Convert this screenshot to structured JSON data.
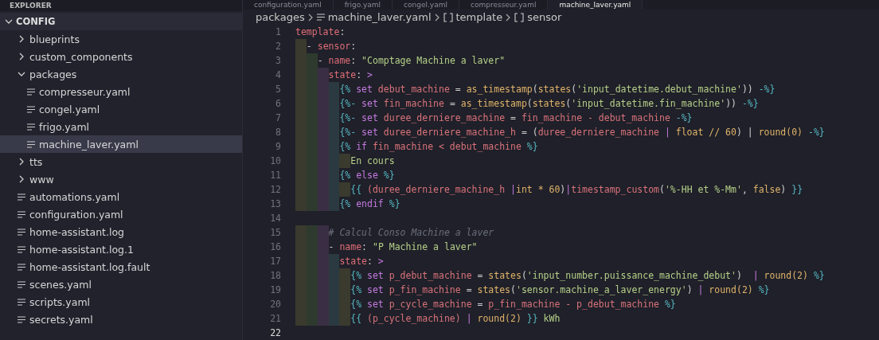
{
  "tabs": [
    {
      "label": "configuration.yaml",
      "selected": false
    },
    {
      "label": "frigo.yaml",
      "selected": false
    },
    {
      "label": "congel.yaml",
      "selected": false
    },
    {
      "label": "compresseur.yaml",
      "selected": false
    },
    {
      "label": "machine_laver.yaml",
      "selected": true
    }
  ],
  "sidebar": {
    "title": "EXPLORER",
    "section": "CONFIG",
    "section_expanded": true,
    "items": [
      {
        "label": "blueprints",
        "kind": "folder",
        "expanded": false,
        "selected": false
      },
      {
        "label": "custom_components",
        "kind": "folder",
        "expanded": false,
        "selected": false
      },
      {
        "label": "packages",
        "kind": "folder",
        "expanded": true,
        "selected": false,
        "children": [
          {
            "label": "compresseur.yaml",
            "kind": "file",
            "selected": false
          },
          {
            "label": "congel.yaml",
            "kind": "file",
            "selected": false
          },
          {
            "label": "frigo.yaml",
            "kind": "file",
            "selected": false
          },
          {
            "label": "machine_laver.yaml",
            "kind": "file",
            "selected": true
          }
        ]
      },
      {
        "label": "tts",
        "kind": "folder",
        "expanded": false,
        "selected": false
      },
      {
        "label": "www",
        "kind": "folder",
        "expanded": false,
        "selected": false
      },
      {
        "label": "automations.yaml",
        "kind": "file",
        "selected": false
      },
      {
        "label": "configuration.yaml",
        "kind": "file",
        "selected": false
      },
      {
        "label": "home-assistant.log",
        "kind": "file",
        "selected": false
      },
      {
        "label": "home-assistant.log.1",
        "kind": "file",
        "selected": false
      },
      {
        "label": "home-assistant.log.fault",
        "kind": "file",
        "selected": false
      },
      {
        "label": "scenes.yaml",
        "kind": "file",
        "selected": false
      },
      {
        "label": "scripts.yaml",
        "kind": "file",
        "selected": false
      },
      {
        "label": "secrets.yaml",
        "kind": "file",
        "selected": false
      }
    ]
  },
  "breadcrumb": [
    {
      "label": "packages",
      "kind": "folder"
    },
    {
      "label": "machine_laver.yaml",
      "kind": "file"
    },
    {
      "label": "template",
      "kind": "symbol"
    },
    {
      "label": "sensor",
      "kind": "symbol"
    }
  ],
  "editor": {
    "lines": [
      {
        "number": "1",
        "tokens": [
          {
            "text": "template",
            "kind": "key"
          },
          {
            "text": ":",
            "kind": "punct"
          }
        ]
      },
      {
        "number": "2",
        "tokens": [
          {
            "text": "  - ",
            "kind": "punct"
          },
          {
            "text": "sensor",
            "kind": "key"
          },
          {
            "text": ":",
            "kind": "punct"
          }
        ]
      },
      {
        "number": "3",
        "tokens": [
          {
            "text": "    - ",
            "kind": "punct"
          },
          {
            "text": "name",
            "kind": "key"
          },
          {
            "text": ": ",
            "kind": "punct"
          },
          {
            "text": "\"Comptage Machine a laver\"",
            "kind": "str"
          }
        ]
      },
      {
        "number": "4",
        "tokens": [
          {
            "text": "      state",
            "kind": "key"
          },
          {
            "text": ": ",
            "kind": "punct"
          },
          {
            "text": ">",
            "kind": "kw"
          }
        ]
      },
      {
        "number": "5",
        "tokens": [
          {
            "text": "        {%",
            "kind": "brace"
          },
          {
            "text": " set ",
            "kind": "kw"
          },
          {
            "text": "debut_machine",
            "kind": "var"
          },
          {
            "text": " = ",
            "kind": "punct"
          },
          {
            "text": "as_timestamp",
            "kind": "fn"
          },
          {
            "text": "(",
            "kind": "punct"
          },
          {
            "text": "states",
            "kind": "fn"
          },
          {
            "text": "(",
            "kind": "punct"
          },
          {
            "text": "'input_datetime.debut_machine'",
            "kind": "str"
          },
          {
            "text": ")) ",
            "kind": "punct"
          },
          {
            "text": "-%}",
            "kind": "brace"
          }
        ]
      },
      {
        "number": "6",
        "tokens": [
          {
            "text": "        {%-",
            "kind": "brace"
          },
          {
            "text": " set ",
            "kind": "kw"
          },
          {
            "text": "fin_machine",
            "kind": "var"
          },
          {
            "text": " = ",
            "kind": "punct"
          },
          {
            "text": "as_timestamp",
            "kind": "fn"
          },
          {
            "text": "(",
            "kind": "punct"
          },
          {
            "text": "states",
            "kind": "fn"
          },
          {
            "text": "(",
            "kind": "punct"
          },
          {
            "text": "'input_datetime.fin_machine'",
            "kind": "str"
          },
          {
            "text": ")) ",
            "kind": "punct"
          },
          {
            "text": "-%}",
            "kind": "brace"
          }
        ]
      },
      {
        "number": "7",
        "tokens": [
          {
            "text": "        {%-",
            "kind": "brace"
          },
          {
            "text": " set ",
            "kind": "kw"
          },
          {
            "text": "duree_derniere_machine",
            "kind": "var"
          },
          {
            "text": " = ",
            "kind": "punct"
          },
          {
            "text": "fin_machine - debut_machine",
            "kind": "var"
          },
          {
            "text": " -%}",
            "kind": "brace"
          }
        ]
      },
      {
        "number": "8",
        "tokens": [
          {
            "text": "        {%-",
            "kind": "brace"
          },
          {
            "text": " set ",
            "kind": "kw"
          },
          {
            "text": "duree_derniere_machine_h",
            "kind": "var"
          },
          {
            "text": " = (",
            "kind": "punct"
          },
          {
            "text": "duree_derniere_machine",
            "kind": "var"
          },
          {
            "text": " | ",
            "kind": "kw"
          },
          {
            "text": "float // 60",
            "kind": "fn"
          },
          {
            "text": ") | ",
            "kind": "punct"
          },
          {
            "text": "round(0)",
            "kind": "fn"
          },
          {
            "text": " -%}",
            "kind": "brace"
          }
        ]
      },
      {
        "number": "9",
        "tokens": [
          {
            "text": "        {%",
            "kind": "brace"
          },
          {
            "text": " if ",
            "kind": "kw"
          },
          {
            "text": "fin_machine < debut_machine",
            "kind": "var"
          },
          {
            "text": " %}",
            "kind": "brace"
          }
        ]
      },
      {
        "number": "10",
        "tokens": [
          {
            "text": "          En cours",
            "kind": "str"
          }
        ]
      },
      {
        "number": "11",
        "tokens": [
          {
            "text": "        {%",
            "kind": "brace"
          },
          {
            "text": " else ",
            "kind": "kw"
          },
          {
            "text": "%}",
            "kind": "brace"
          }
        ]
      },
      {
        "number": "12",
        "tokens": [
          {
            "text": "          {{ ",
            "kind": "brace"
          },
          {
            "text": "(duree_derniere_machine_h ",
            "kind": "var"
          },
          {
            "text": "|",
            "kind": "kw"
          },
          {
            "text": "int * 60",
            "kind": "fn"
          },
          {
            "text": ")",
            "kind": "punct"
          },
          {
            "text": "|",
            "kind": "kw"
          },
          {
            "text": "timestamp_custom",
            "kind": "var"
          },
          {
            "text": "(",
            "kind": "punct"
          },
          {
            "text": "'%-HH et %-Mm'",
            "kind": "str"
          },
          {
            "text": ", ",
            "kind": "punct"
          },
          {
            "text": "false",
            "kind": "fn"
          },
          {
            "text": ") ",
            "kind": "punct"
          },
          {
            "text": "}}",
            "kind": "brace"
          }
        ]
      },
      {
        "number": "13",
        "tokens": [
          {
            "text": "        {%",
            "kind": "brace"
          },
          {
            "text": " endif ",
            "kind": "kw"
          },
          {
            "text": "%}",
            "kind": "brace"
          }
        ]
      },
      {
        "number": "14"
      },
      {
        "number": "15",
        "tokens": [
          {
            "text": "      # Calcul Conso Machine a laver",
            "kind": "comment"
          }
        ]
      },
      {
        "number": "16",
        "tokens": [
          {
            "text": "      - ",
            "kind": "punct"
          },
          {
            "text": "name",
            "kind": "key"
          },
          {
            "text": ": ",
            "kind": "punct"
          },
          {
            "text": "\"P Machine a laver\"",
            "kind": "str"
          }
        ]
      },
      {
        "number": "17",
        "tokens": [
          {
            "text": "        state",
            "kind": "key"
          },
          {
            "text": ": ",
            "kind": "punct"
          },
          {
            "text": ">",
            "kind": "kw"
          }
        ]
      },
      {
        "number": "18",
        "tokens": [
          {
            "text": "          {%",
            "kind": "brace"
          },
          {
            "text": " set ",
            "kind": "kw"
          },
          {
            "text": "p_debut_machine",
            "kind": "var"
          },
          {
            "text": " = ",
            "kind": "punct"
          },
          {
            "text": "states",
            "kind": "fn"
          },
          {
            "text": "(",
            "kind": "punct"
          },
          {
            "text": "'input_number.puissance_machine_debut'",
            "kind": "str"
          },
          {
            "text": ")  ",
            "kind": "punct"
          },
          {
            "text": "| ",
            "kind": "kw"
          },
          {
            "text": "round(2)",
            "kind": "fn"
          },
          {
            "text": " %}",
            "kind": "brace"
          }
        ]
      },
      {
        "number": "19",
        "tokens": [
          {
            "text": "          {%",
            "kind": "brace"
          },
          {
            "text": " set ",
            "kind": "kw"
          },
          {
            "text": "p_fin_machine",
            "kind": "var"
          },
          {
            "text": " = ",
            "kind": "punct"
          },
          {
            "text": "states",
            "kind": "fn"
          },
          {
            "text": "(",
            "kind": "punct"
          },
          {
            "text": "'sensor.machine_a_laver_energy'",
            "kind": "str"
          },
          {
            "text": ") ",
            "kind": "punct"
          },
          {
            "text": "| ",
            "kind": "kw"
          },
          {
            "text": "round(2)",
            "kind": "fn"
          },
          {
            "text": " %}",
            "kind": "brace"
          }
        ]
      },
      {
        "number": "20",
        "tokens": [
          {
            "text": "          {%",
            "kind": "brace"
          },
          {
            "text": " set ",
            "kind": "kw"
          },
          {
            "text": "p_cycle_machine",
            "kind": "var"
          },
          {
            "text": " = ",
            "kind": "punct"
          },
          {
            "text": "p_fin_machine - p_debut_machine",
            "kind": "var"
          },
          {
            "text": " %}",
            "kind": "brace"
          }
        ]
      },
      {
        "number": "21",
        "tokens": [
          {
            "text": "          {{ ",
            "kind": "brace"
          },
          {
            "text": "(p_cycle_machine) ",
            "kind": "var"
          },
          {
            "text": "| ",
            "kind": "kw"
          },
          {
            "text": "round(2)",
            "kind": "fn"
          },
          {
            "text": " }}",
            "kind": "brace"
          },
          {
            "text": " kWh",
            "kind": "str"
          }
        ]
      },
      {
        "number": "22"
      }
    ]
  }
}
